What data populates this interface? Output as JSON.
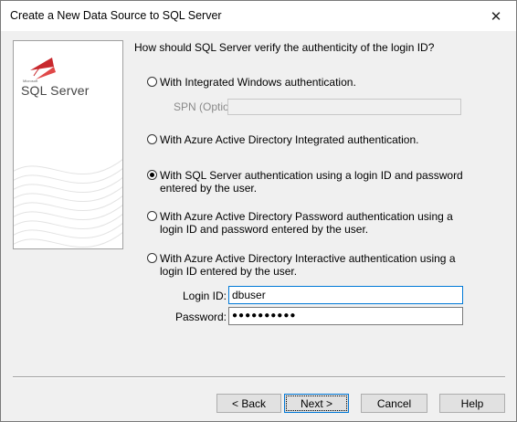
{
  "window": {
    "title": "Create a New Data Source to SQL Server",
    "close_glyph": "✕"
  },
  "banner": {
    "brand_small": "Microsoft",
    "brand": "SQL Server"
  },
  "question": "How should SQL Server verify the authenticity of the login ID?",
  "options": [
    {
      "label": "With Integrated Windows authentication.",
      "checked": false
    },
    {
      "label": "With Azure Active Directory Integrated authentication.",
      "checked": false
    },
    {
      "label": "With SQL Server authentication using a login ID and password entered by the user.",
      "checked": true
    },
    {
      "label": "With Azure Active Directory Password authentication using a login ID and password entered by the user.",
      "checked": false
    },
    {
      "label": "With Azure Active Directory Interactive authentication using a login ID entered by the user.",
      "checked": false
    }
  ],
  "spn": {
    "label": "SPN (Optional):",
    "value": ""
  },
  "login": {
    "label": "Login ID:",
    "value": "dbuser"
  },
  "password": {
    "label": "Password:",
    "value": "●●●●●●●●●●"
  },
  "buttons": {
    "back": "< Back",
    "next": "Next >",
    "cancel": "Cancel",
    "help": "Help"
  },
  "colors": {
    "accent": "#0078d7",
    "logo": "#c8282d",
    "face": "#f0f0f0"
  }
}
